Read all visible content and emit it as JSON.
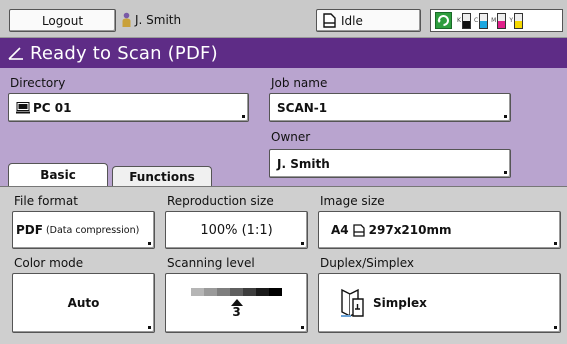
{
  "header": {
    "logout_label": "Logout",
    "user_name": "J. Smith",
    "status_label": "Idle",
    "toner": [
      {
        "label": "K",
        "color": "#111111",
        "level": 0.5
      },
      {
        "label": "C",
        "color": "#1ca7e0",
        "level": 0.5
      },
      {
        "label": "M",
        "color": "#e0208a",
        "level": 0.5
      },
      {
        "label": "Y",
        "color": "#f5d800",
        "level": 0.5
      }
    ]
  },
  "title": "Ready to Scan (PDF)",
  "settings": {
    "directory_label": "Directory",
    "directory_value": "PC 01",
    "job_name_label": "Job name",
    "job_name_value": "SCAN-1",
    "owner_label": "Owner",
    "owner_value": "J. Smith"
  },
  "tabs": [
    {
      "label": "Basic",
      "active": true
    },
    {
      "label": "Functions",
      "active": false
    }
  ],
  "options": {
    "file_format_label": "File format",
    "file_format_main": "PDF",
    "file_format_sub": "(Data compression)",
    "reproduction_label": "Reproduction size",
    "reproduction_value": "100% (1:1)",
    "image_size_label": "Image size",
    "image_size_paper": "A4",
    "image_size_dims": "297x210mm",
    "color_mode_label": "Color mode",
    "color_mode_value": "Auto",
    "scanning_level_label": "Scanning level",
    "scanning_level_value": "3",
    "duplex_label": "Duplex/Simplex",
    "duplex_value": "Simplex"
  },
  "colors": {
    "title_bar": "#5e2c86",
    "panel": "#b9a4cf"
  }
}
